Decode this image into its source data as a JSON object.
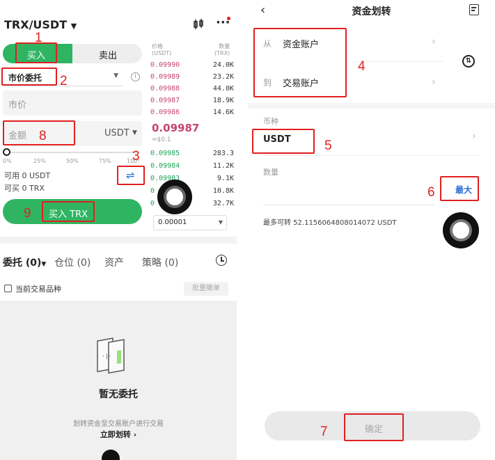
{
  "left": {
    "pair": "TRX/USDT",
    "buy_label": "买入",
    "sell_label": "卖出",
    "order_type": "市价委托",
    "price_placeholder": "市价",
    "amount_placeholder": "金额",
    "amount_unit": "USDT",
    "slider_marks": [
      "0%",
      "25%",
      "50%",
      "75%",
      "100%"
    ],
    "available": "可用 0 USDT",
    "can_buy": "可买 0 TRX",
    "buy_button": "买入 TRX",
    "orderbook": {
      "col_price": "价格\n(USDT)",
      "col_qty": "数量\n(TRX)",
      "asks": [
        {
          "price": "0.09990",
          "qty": "24.0K"
        },
        {
          "price": "0.09989",
          "qty": "23.2K"
        },
        {
          "price": "0.09988",
          "qty": "44.0K"
        },
        {
          "price": "0.09987",
          "qty": "18.9K"
        },
        {
          "price": "0.09986",
          "qty": "14.6K"
        }
      ],
      "last_price": "0.09987",
      "last_price_usd": "≈$0.1",
      "bids": [
        {
          "price": "0.09985",
          "qty": "283.3"
        },
        {
          "price": "0.09984",
          "qty": "11.2K"
        },
        {
          "price": "0.09983",
          "qty": "9.1K"
        },
        {
          "price": "0",
          "qty": "10.8K"
        },
        {
          "price": "0",
          "qty": "32.7K"
        }
      ],
      "precision": "0.00001"
    },
    "tabs": [
      {
        "label": "委托 (0)"
      },
      {
        "label": "仓位 (0)"
      },
      {
        "label": "资产"
      },
      {
        "label": "策略 (0)"
      }
    ],
    "current_only": "当前交易品种",
    "batch_cancel": "批量撤单",
    "empty_title": "暂无委托",
    "empty_desc": "划转资金至交易账户进行交易",
    "transfer_link": "立即划转 ›"
  },
  "right": {
    "title": "资金划转",
    "from_label": "从",
    "from_account": "资金账户",
    "to_label": "到",
    "to_account": "交易账户",
    "currency_label": "币种",
    "currency": "USDT",
    "quantity_label": "数量",
    "max_label": "最大",
    "max_transfer": "最多可转 52.1156064808014072 USDT",
    "confirm": "确定"
  },
  "annotations": [
    "1",
    "2",
    "3",
    "4",
    "5",
    "6",
    "7",
    "8",
    "9"
  ],
  "colors": {
    "green": "#2fb562",
    "red": "#e02020",
    "ask": "#c4456e",
    "bid": "#1fa657",
    "link": "#2a6fd8"
  }
}
